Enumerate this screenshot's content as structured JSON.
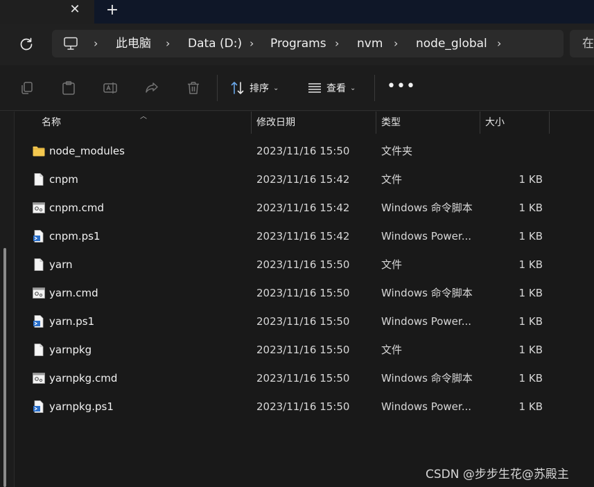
{
  "tabs": {
    "close_glyph": "✕",
    "new_glyph": "+"
  },
  "address": {
    "breadcrumbs": [
      "此电脑",
      "Data (D:)",
      "Programs",
      "nvm",
      "node_global"
    ],
    "separator": "›",
    "search_partial": "在"
  },
  "toolbar": {
    "sort_label": "排序",
    "view_label": "查看",
    "more_glyph": "•••"
  },
  "columns": {
    "name": "名称",
    "date": "修改日期",
    "type": "类型",
    "size": "大小"
  },
  "files": [
    {
      "name": "node_modules",
      "date": "2023/11/16 15:50",
      "type": "文件夹",
      "size": "",
      "icon": "folder-icon"
    },
    {
      "name": "cnpm",
      "date": "2023/11/16 15:42",
      "type": "文件",
      "size": "1 KB",
      "icon": "file-icon"
    },
    {
      "name": "cnpm.cmd",
      "date": "2023/11/16 15:42",
      "type": "Windows 命令脚本",
      "size": "1 KB",
      "icon": "cmd-script-icon"
    },
    {
      "name": "cnpm.ps1",
      "date": "2023/11/16 15:42",
      "type": "Windows Power...",
      "size": "1 KB",
      "icon": "powershell-script-icon"
    },
    {
      "name": "yarn",
      "date": "2023/11/16 15:50",
      "type": "文件",
      "size": "1 KB",
      "icon": "file-icon"
    },
    {
      "name": "yarn.cmd",
      "date": "2023/11/16 15:50",
      "type": "Windows 命令脚本",
      "size": "1 KB",
      "icon": "cmd-script-icon"
    },
    {
      "name": "yarn.ps1",
      "date": "2023/11/16 15:50",
      "type": "Windows Power...",
      "size": "1 KB",
      "icon": "powershell-script-icon"
    },
    {
      "name": "yarnpkg",
      "date": "2023/11/16 15:50",
      "type": "文件",
      "size": "1 KB",
      "icon": "file-icon"
    },
    {
      "name": "yarnpkg.cmd",
      "date": "2023/11/16 15:50",
      "type": "Windows 命令脚本",
      "size": "1 KB",
      "icon": "cmd-script-icon"
    },
    {
      "name": "yarnpkg.ps1",
      "date": "2023/11/16 15:50",
      "type": "Windows Power...",
      "size": "1 KB",
      "icon": "powershell-script-icon"
    }
  ],
  "watermark": "CSDN @步步生花@苏殿主",
  "colors": {
    "background": "#191919",
    "tabstrip": "#0f1728",
    "addressbar": "#2b2b2b",
    "folder": "#f2c94c"
  }
}
